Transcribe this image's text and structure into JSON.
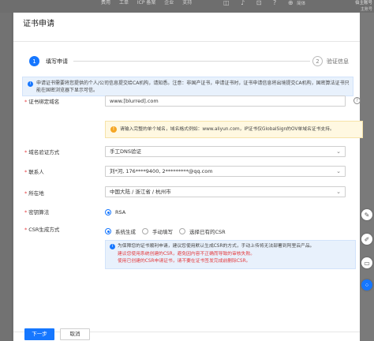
{
  "topbar": {
    "nav": [
      "费用",
      "工单",
      "ICP 备案",
      "企业",
      "支持"
    ],
    "account_name": "伯主账号",
    "account_sub": "主账号",
    "lang_label": "简体"
  },
  "drawer": {
    "title": "证书申请",
    "steps": [
      {
        "index": "1",
        "label": "填写申请"
      },
      {
        "index": "2",
        "label": "验证信息"
      }
    ],
    "notice": "申请证书需要将您提供的个人/公司信息提交给CA机构，请知悉。注意：非国产证书，申请证书时，证书申请信息将出境提交CA机构，国密算法证书只能在国密浏览器下显示可信。"
  },
  "form": {
    "domain": {
      "label": "证书绑定域名",
      "value": "www.[blurred].com"
    },
    "domain_tip": "请输入完整的单个域名，域名格式例如：www.aliyun.com，IP证书仅GlobalSign的OV单域名证书支持。",
    "verify": {
      "label": "域名验证方式",
      "value": "手工DNS验证"
    },
    "contact": {
      "label": "联系人",
      "value": "刘*河, 176****9400, 2*********@qq.com"
    },
    "location": {
      "label": "所在地",
      "value": "中国大陆 / 浙江省 / 杭州市"
    },
    "algo": {
      "label": "密钥算法",
      "option": "RSA"
    },
    "csr": {
      "label": "CSR生成方式",
      "options": [
        "系统生成",
        "手动填写",
        "选择已有的CSR"
      ],
      "info_line1": "为保障您的证书顺利申请，建议您使用默认生成CSR的方式，手动上传将无法部署到阿里云产品。",
      "info_line2": "建议您使用系统创建的CSR，避免因内容不正确而导致的审核失败。",
      "info_line3": "使用已创建的CSR申请证书，请不要在证书签发完成前删除CSR。"
    }
  },
  "footer": {
    "next_label": "下一步",
    "cancel_label": "取消"
  },
  "colors": {
    "accent": "#1677ff",
    "required": "#e4393c",
    "warning_bg": "#fff8e1"
  }
}
